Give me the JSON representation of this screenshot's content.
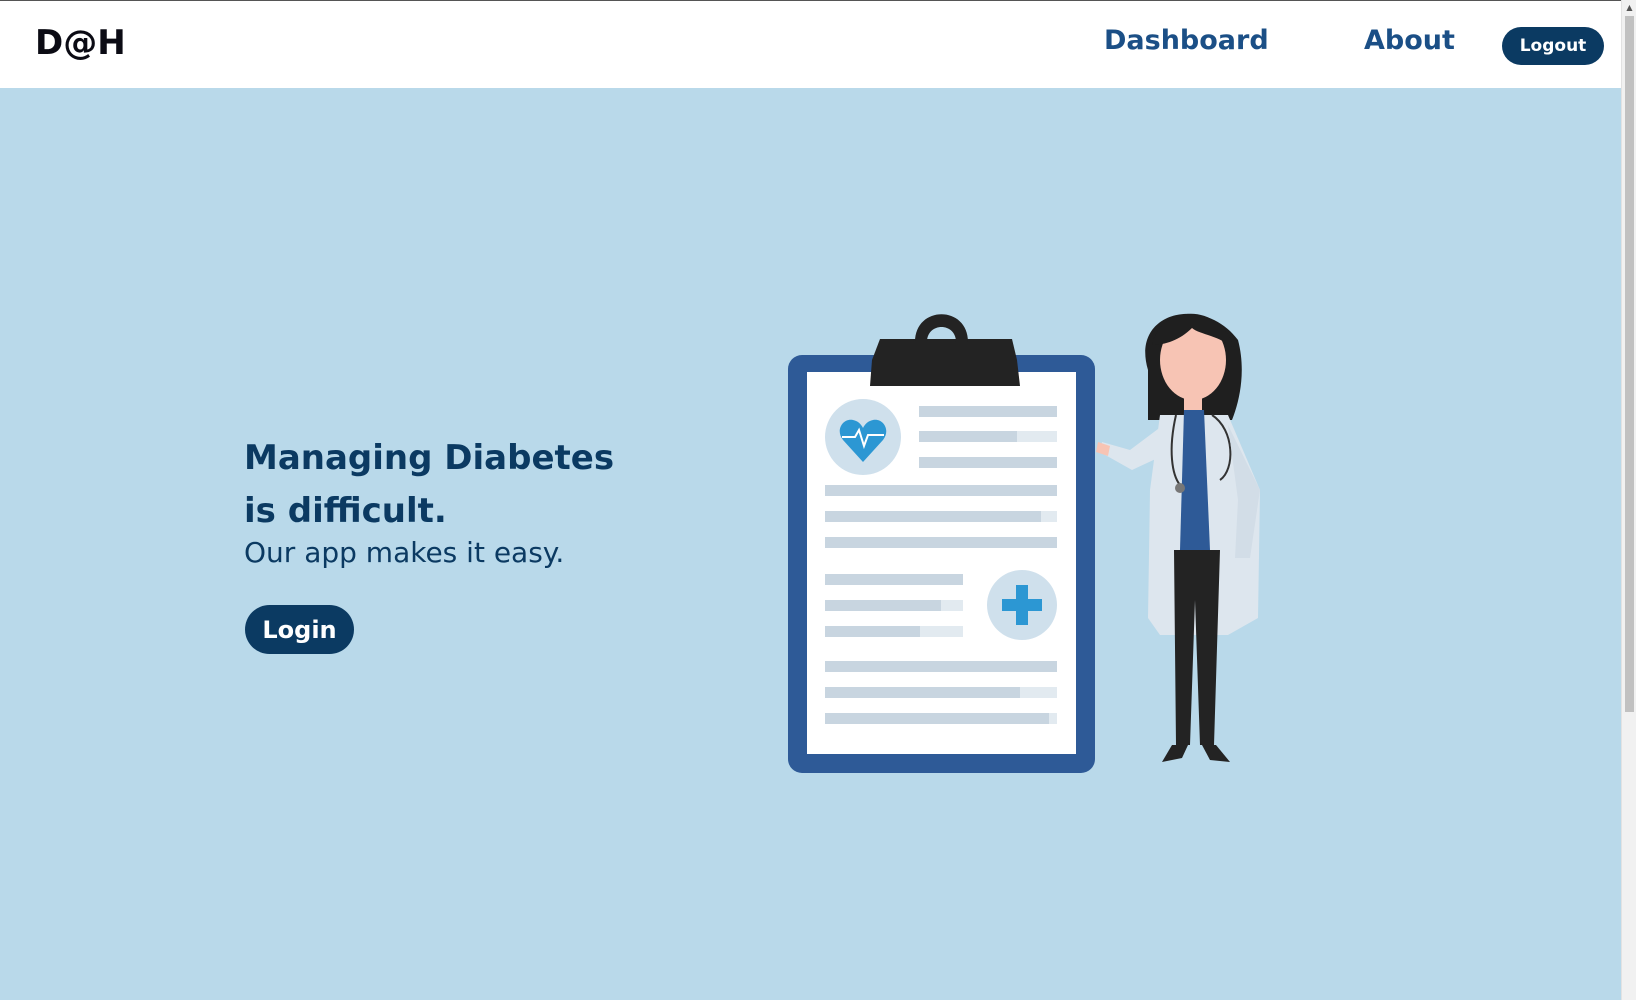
{
  "navbar": {
    "logo": "D@H",
    "links": [
      {
        "label": "Dashboard"
      },
      {
        "label": "About"
      }
    ],
    "logout_label": "Logout"
  },
  "hero": {
    "title_line1": "Managing Diabetes",
    "title_line2": "is difficult.",
    "subtitle": "Our app makes it easy.",
    "login_label": "Login"
  },
  "colors": {
    "background": "#b9d9ea",
    "primary": "#0b3a62",
    "link": "#1b4f86",
    "navbar": "#ffffff"
  },
  "icons": [
    "heart-icon",
    "medical-cross-icon",
    "clipboard-illustration",
    "doctor-illustration"
  ]
}
